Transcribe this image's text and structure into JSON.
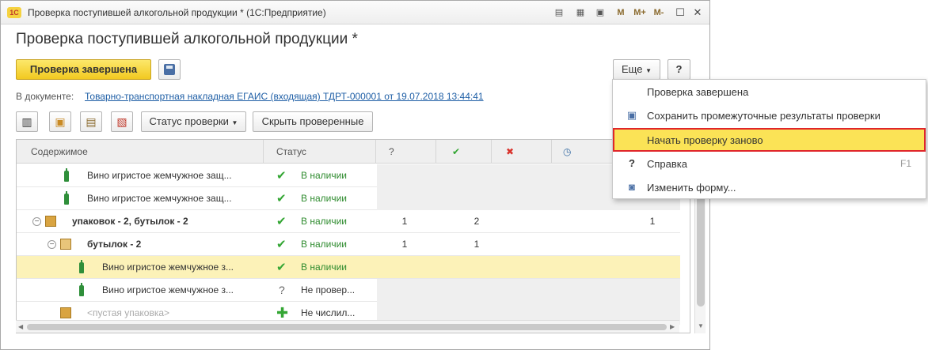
{
  "window": {
    "title": "Проверка поступившей алкогольной продукции * (1С:Предприятие)",
    "logo": "1С",
    "title_icons": [
      "print-icon",
      "calc-icon",
      "calendar-icon"
    ],
    "memory_buttons": [
      "M",
      "M+",
      "M-"
    ]
  },
  "form": {
    "title": "Проверка поступившей алкогольной продукции *",
    "primary_button": "Проверка завершена",
    "more_button": "Еще",
    "help_button": "?",
    "doc_label": "В документе:",
    "doc_link": "Товарно-транспортная накладная ЕГАИС (входящая) ТДРТ-000001 от 19.07.2018 13:44:41",
    "status_button": "Статус проверки",
    "hide_checked_button": "Скрыть проверенные"
  },
  "grid": {
    "columns": [
      "Содержимое",
      "Статус",
      "?",
      "✔",
      "✖",
      "◷"
    ],
    "rows": [
      {
        "content": "Вино игристое жемчужное защ...",
        "status": "В наличии",
        "status_icon": "check-icon",
        "c1": "",
        "c2": "",
        "c3": "",
        "c4": ""
      },
      {
        "content": "Вино игристое жемчужное защ...",
        "status": "В наличии",
        "status_icon": "check-icon",
        "c1": "",
        "c2": "",
        "c3": "",
        "c4": ""
      },
      {
        "content": "упаковок - 2, бутылок - 2",
        "status": "В наличии",
        "status_icon": "check-icon",
        "c1": "1",
        "c2": "2",
        "c3": "",
        "c4": "1"
      },
      {
        "content": "бутылок - 2",
        "status": "В наличии",
        "status_icon": "check-icon",
        "c1": "1",
        "c2": "1",
        "c3": "",
        "c4": ""
      },
      {
        "content": "Вино игристое жемчужное з...",
        "status": "В наличии",
        "status_icon": "check-icon",
        "c1": "",
        "c2": "",
        "c3": "",
        "c4": ""
      },
      {
        "content": "Вино игристое жемчужное з...",
        "status": "Не провер...",
        "status_icon": "question-icon",
        "c1": "",
        "c2": "",
        "c3": "",
        "c4": ""
      },
      {
        "content": "<пустая упаковка>",
        "status": "Не числил...",
        "status_icon": "plus-icon",
        "c1": "",
        "c2": "",
        "c3": "",
        "c4": ""
      }
    ]
  },
  "menu": {
    "items": [
      {
        "label": "Проверка завершена",
        "icon": "",
        "hotkey": ""
      },
      {
        "label": "Сохранить промежуточные результаты проверки",
        "icon": "save-icon",
        "hotkey": ""
      },
      {
        "label": "Начать проверку заново",
        "icon": "",
        "hotkey": ""
      },
      {
        "label": "Справка",
        "icon": "help-icon",
        "hotkey": "F1"
      },
      {
        "label": "Изменить форму...",
        "icon": "form-settings-icon",
        "hotkey": ""
      }
    ],
    "highlight_color": "#fbe356",
    "highlight_border": "#e0262a"
  },
  "colors": {
    "primary_button": "#f2c920",
    "link": "#1f5fa6",
    "selected_row": "#fcf2b8",
    "check": "#34a634"
  }
}
